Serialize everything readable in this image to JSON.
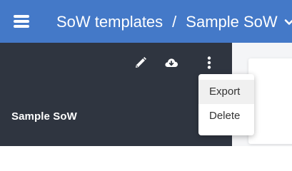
{
  "header": {
    "menu_icon": "hamburger-menu-icon",
    "breadcrumb": {
      "parent": "SoW templates",
      "separator": "/",
      "current": "Sample SoW",
      "dropdown_icon": "chevron-down-icon"
    }
  },
  "sidebar": {
    "toolbar": {
      "edit_icon": "pencil-icon",
      "download_icon": "cloud-download-icon",
      "more_icon": "more-vertical-icon"
    },
    "sow_title": "Sample SoW"
  },
  "context_menu": {
    "items": [
      {
        "label": "Export",
        "highlighted": true
      },
      {
        "label": "Delete",
        "highlighted": false
      }
    ]
  },
  "colors": {
    "header_bg": "#4479c8",
    "sidebar_bg": "#2f3540",
    "content_bg": "#f4f5f7",
    "menu_bg": "#ffffff",
    "menu_hover_bg": "#f0f0f0"
  }
}
